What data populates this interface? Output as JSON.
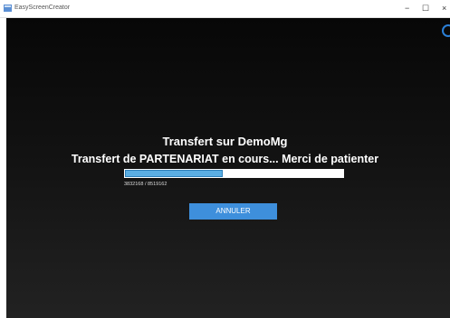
{
  "window": {
    "title": "EasyScreenCreator",
    "minimize_glyph": "−",
    "maximize_glyph": "☐",
    "close_glyph": "×"
  },
  "transfer": {
    "heading": "Transfert sur DemoMg",
    "status": "Transfert de PARTENARIAT en cours... Merci de patienter",
    "counter_text": "3832168 / 8519162",
    "progress_fraction": 0.4498
  },
  "buttons": {
    "cancel_label": "ANNULER"
  },
  "colors": {
    "accent": "#3e8fdc",
    "progress_fill": "#5aaee3",
    "background": "#111111"
  }
}
